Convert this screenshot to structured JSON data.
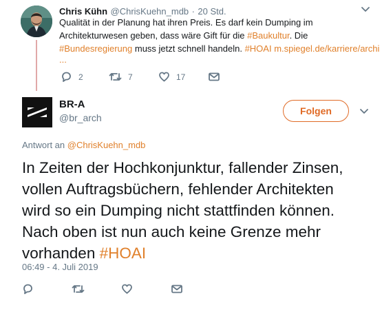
{
  "reply_tweet": {
    "author_name": "Chris Kühn",
    "author_handle": "@ChrisKuehn_mdb",
    "separator": "·",
    "time": "20 Std.",
    "text_line1": "Qualität in der Planung hat ihren Preis. Es darf kein Dumping im",
    "text_line2_prefix": "Architekturwesen geben, dass wäre Gift für die ",
    "hashtag_baukultur": "#Baukultur",
    "text_line2_suffix": ". Die",
    "hashtag_bundesregierung": "#Bundesregierung",
    "text_line3_middle": " muss jetzt schnell handeln. ",
    "hashtag_hoai": "#HOAI",
    "link_text": "m.spiegel.de/karriere/archi",
    "ellipsis": "...",
    "reply_count": "2",
    "retweet_count": "7",
    "like_count": "17"
  },
  "main_tweet": {
    "author_name": "BR-A",
    "author_handle": "@br_arch",
    "follow_label": "Folgen",
    "reply_to_prefix": "Antwort an ",
    "reply_to_handle": "@ChrisKuehn_mdb",
    "text": "In Zeiten der Hochkonjunktur, fallender Zinsen, vollen Auftragsbüchern, fehlender Architekten wird so ein Dumping nicht stattfinden können. Nach oben ist nun auch keine Grenze mehr vorhanden ",
    "hashtag": "#HOAI",
    "timestamp": "06:49 - 4. Juli 2019"
  },
  "colors": {
    "accent": "#e0802b",
    "follow_border": "#e06a25",
    "muted": "#657786",
    "thread_line": "#e1a8a8"
  },
  "icons": [
    "reply-icon",
    "retweet-icon",
    "like-icon",
    "message-icon",
    "chevron-down-icon"
  ]
}
